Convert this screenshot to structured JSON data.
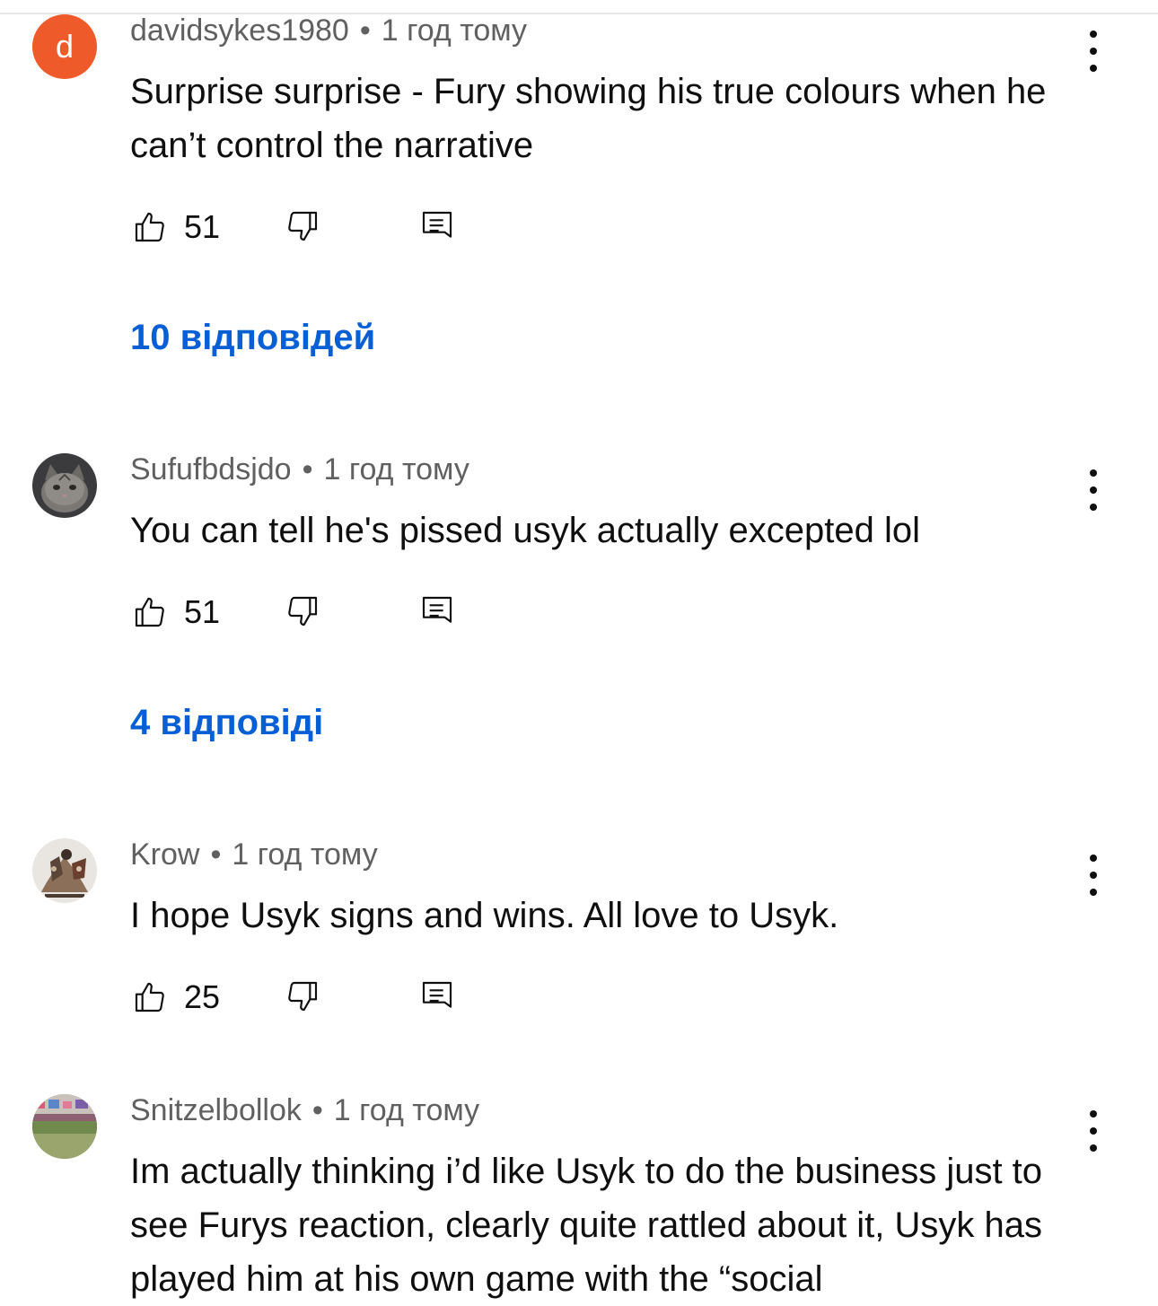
{
  "comments": [
    {
      "author": "davidsykes1980",
      "time": "1 год тому",
      "avatar_letter": "d",
      "text": "Surprise surprise - Fury showing his true colours when he can’t control the narrative",
      "likes": "51",
      "replies": "10 відповідей"
    },
    {
      "author": "Sufufbdsjdo",
      "time": "1 год тому",
      "text": "You can tell he's pissed usyk actually excepted lol",
      "likes": "51",
      "replies": "4 відповіді"
    },
    {
      "author": "Krow",
      "time": "1 год тому",
      "text": "I hope Usyk signs and wins. All love to Usyk.",
      "likes": "25"
    },
    {
      "author": "Snitzelbollok",
      "time": "1 год тому",
      "text": "Im actually thinking i’d like Usyk to do the business just to see Furys reaction, clearly quite rattled about it, Usyk has played him at his own game with the “social"
    }
  ],
  "separator": "•",
  "icons": {
    "like": "thumbs-up-icon",
    "dislike": "thumbs-down-icon",
    "reply": "reply-comment-icon",
    "more": "more-vertical-icon"
  },
  "colors": {
    "link": "#065fd4",
    "meta": "#606060",
    "text": "#0f0f0f",
    "avatar_d": "#ef5a2b"
  }
}
